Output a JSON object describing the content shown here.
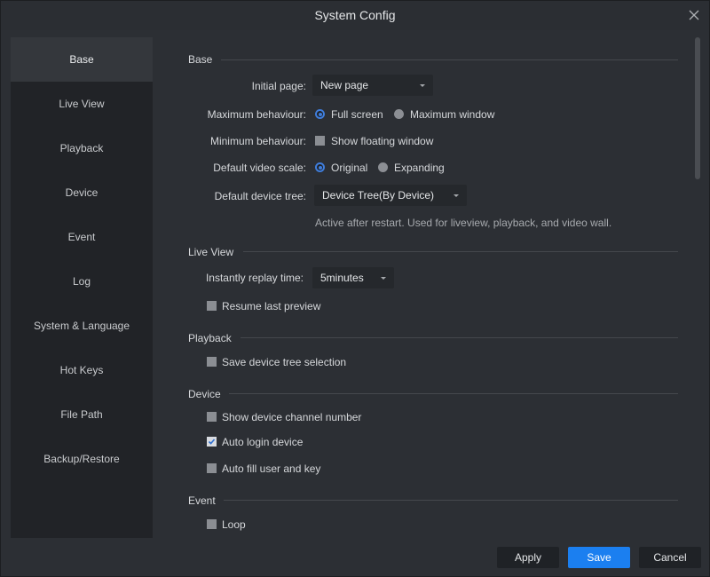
{
  "window": {
    "title": "System Config"
  },
  "sidebar": {
    "items": [
      {
        "label": "Base",
        "active": true
      },
      {
        "label": "Live View"
      },
      {
        "label": "Playback"
      },
      {
        "label": "Device"
      },
      {
        "label": "Event"
      },
      {
        "label": "Log"
      },
      {
        "label": "System & Language"
      },
      {
        "label": "Hot Keys"
      },
      {
        "label": "File Path"
      },
      {
        "label": "Backup/Restore"
      }
    ]
  },
  "base": {
    "title": "Base",
    "initial_page": {
      "label": "Initial page:",
      "value": "New page"
    },
    "max_behaviour": {
      "label": "Maximum behaviour:",
      "opt1": "Full screen",
      "opt2": "Maximum window",
      "selected": "Full screen"
    },
    "min_behaviour": {
      "label": "Minimum behaviour:",
      "opt": "Show floating window",
      "checked": false
    },
    "video_scale": {
      "label": "Default video scale:",
      "opt1": "Original",
      "opt2": "Expanding",
      "selected": "Original"
    },
    "device_tree": {
      "label": "Default device tree:",
      "value": "Device Tree(By Device)"
    },
    "hint": "Active after restart. Used for liveview, playback, and video wall."
  },
  "liveview": {
    "title": "Live View",
    "replay_time": {
      "label": "Instantly replay time:",
      "value": "5minutes"
    },
    "resume": {
      "label": "Resume last preview",
      "checked": false
    }
  },
  "playback": {
    "title": "Playback",
    "save_tree": {
      "label": "Save device tree selection",
      "checked": false
    }
  },
  "device": {
    "title": "Device",
    "show_channel": {
      "label": "Show device channel number",
      "checked": false
    },
    "auto_login": {
      "label": "Auto login device",
      "checked": true
    },
    "auto_fill": {
      "label": "Auto fill user and key",
      "checked": false
    }
  },
  "event": {
    "title": "Event",
    "loop": {
      "label": "Loop",
      "checked": false
    }
  },
  "footer": {
    "apply": "Apply",
    "save": "Save",
    "cancel": "Cancel"
  },
  "colors": {
    "accent": "#1b7ff0",
    "radio_on": "#3f7ddb"
  }
}
